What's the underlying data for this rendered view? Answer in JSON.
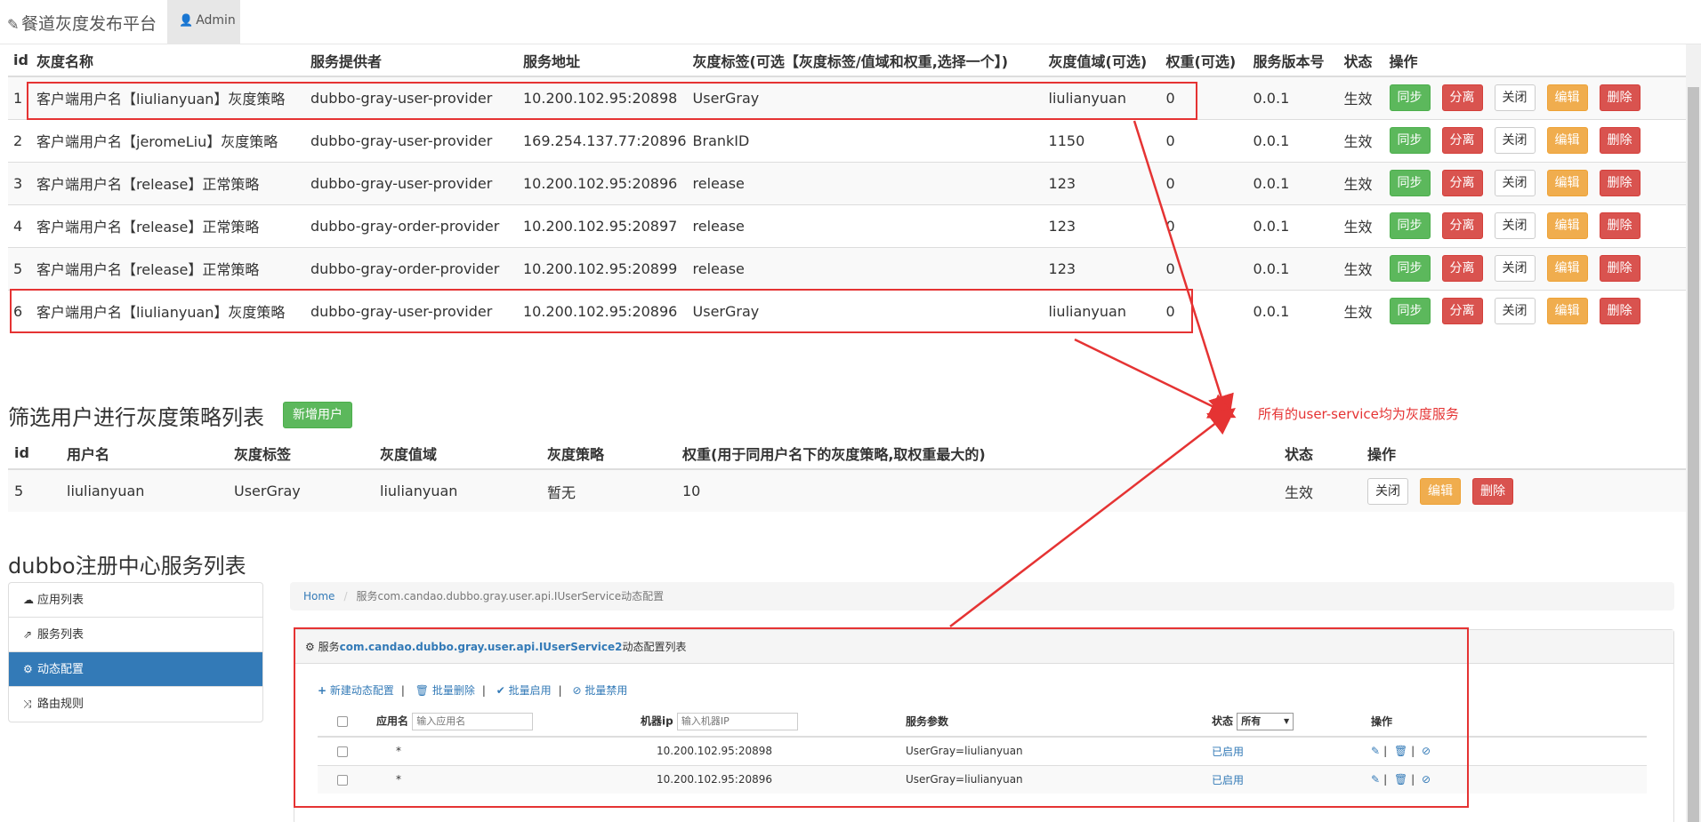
{
  "nav": {
    "brand": "餐道灰度发布平台",
    "admin": "Admin"
  },
  "strategy_table": {
    "headers": [
      "id",
      "灰度名称",
      "服务提供者",
      "服务地址",
      "灰度标签(可选【灰度标签/值域和权重,选择一个】)",
      "灰度值域(可选)",
      "权重(可选)",
      "服务版本号",
      "状态",
      "操作"
    ],
    "actions": [
      "同步",
      "分离",
      "关闭",
      "编辑",
      "删除"
    ],
    "rows": [
      {
        "id": "1",
        "name": "客户端用户名【liulianyuan】灰度策略",
        "provider": "dubbo-gray-user-provider",
        "address": "10.200.102.95:20898",
        "tag": "UserGray",
        "range": "liulianyuan",
        "weight": "0",
        "version": "0.0.1",
        "status": "生效"
      },
      {
        "id": "2",
        "name": "客户端用户名【jeromeLiu】灰度策略",
        "provider": "dubbo-gray-user-provider",
        "address": "169.254.137.77:20896",
        "tag": "BrankID",
        "range": "1150",
        "weight": "0",
        "version": "0.0.1",
        "status": "生效"
      },
      {
        "id": "3",
        "name": "客户端用户名【release】正常策略",
        "provider": "dubbo-gray-user-provider",
        "address": "10.200.102.95:20896",
        "tag": "release",
        "range": "123",
        "weight": "0",
        "version": "0.0.1",
        "status": "生效"
      },
      {
        "id": "4",
        "name": "客户端用户名【release】正常策略",
        "provider": "dubbo-gray-order-provider",
        "address": "10.200.102.95:20897",
        "tag": "release",
        "range": "123",
        "weight": "0",
        "version": "0.0.1",
        "status": "生效"
      },
      {
        "id": "5",
        "name": "客户端用户名【release】正常策略",
        "provider": "dubbo-gray-order-provider",
        "address": "10.200.102.95:20899",
        "tag": "release",
        "range": "123",
        "weight": "0",
        "version": "0.0.1",
        "status": "生效"
      },
      {
        "id": "6",
        "name": "客户端用户名【liulianyuan】灰度策略",
        "provider": "dubbo-gray-user-provider",
        "address": "10.200.102.95:20896",
        "tag": "UserGray",
        "range": "liulianyuan",
        "weight": "0",
        "version": "0.0.1",
        "status": "生效"
      }
    ]
  },
  "user_section": {
    "title": "筛选用户进行灰度策略列表",
    "add_button": "新增用户",
    "headers": [
      "id",
      "用户名",
      "灰度标签",
      "灰度值域",
      "灰度策略",
      "权重(用于同用户名下的灰度策略,取权重最大的)",
      "状态",
      "操作"
    ],
    "actions": [
      "关闭",
      "编辑",
      "删除"
    ],
    "rows": [
      {
        "id": "5",
        "username": "liulianyuan",
        "tag": "UserGray",
        "range": "liulianyuan",
        "strategy": "暂无",
        "weight": "10",
        "status": "生效"
      }
    ]
  },
  "registry_section": {
    "title": "dubbo注册中心服务列表",
    "sidebar": [
      {
        "label": "应用列表",
        "icon": "cloud-icon"
      },
      {
        "label": "服务列表",
        "icon": "share-icon"
      },
      {
        "label": "动态配置",
        "icon": "cogs-icon",
        "active": true
      },
      {
        "label": "路由规则",
        "icon": "random-icon"
      }
    ],
    "breadcrumb": {
      "home": "Home",
      "current": "服务com.candao.dubbo.gray.user.api.IUserService动态配置"
    },
    "panel": {
      "heading_prefix": "服务",
      "heading_service": "com.candao.dubbo.gray.user.api.IUserService2",
      "heading_suffix": "动态配置列表",
      "toolbar": [
        "新建动态配置",
        "批量删除",
        "批量启用",
        "批量禁用"
      ],
      "filters": {
        "app_label": "应用名",
        "app_placeholder": "输入应用名",
        "ip_label": "机器ip",
        "ip_placeholder": "输入机器IP",
        "params_label": "服务参数",
        "status_label": "状态",
        "status_value": "所有",
        "ops_label": "操作"
      },
      "rows": [
        {
          "app": "*",
          "ip": "10.200.102.95:20898",
          "params": "UserGray=liulianyuan",
          "status": "已启用"
        },
        {
          "app": "*",
          "ip": "10.200.102.95:20896",
          "params": "UserGray=liulianyuan",
          "status": "已启用"
        }
      ]
    }
  },
  "annotation": {
    "text": "所有的user-service均为灰度服务",
    "color": "#e53333"
  },
  "colors": {
    "primary": "#337ab7",
    "success": "#5cb85c",
    "danger": "#d9534f",
    "warning": "#f0ad4e"
  }
}
